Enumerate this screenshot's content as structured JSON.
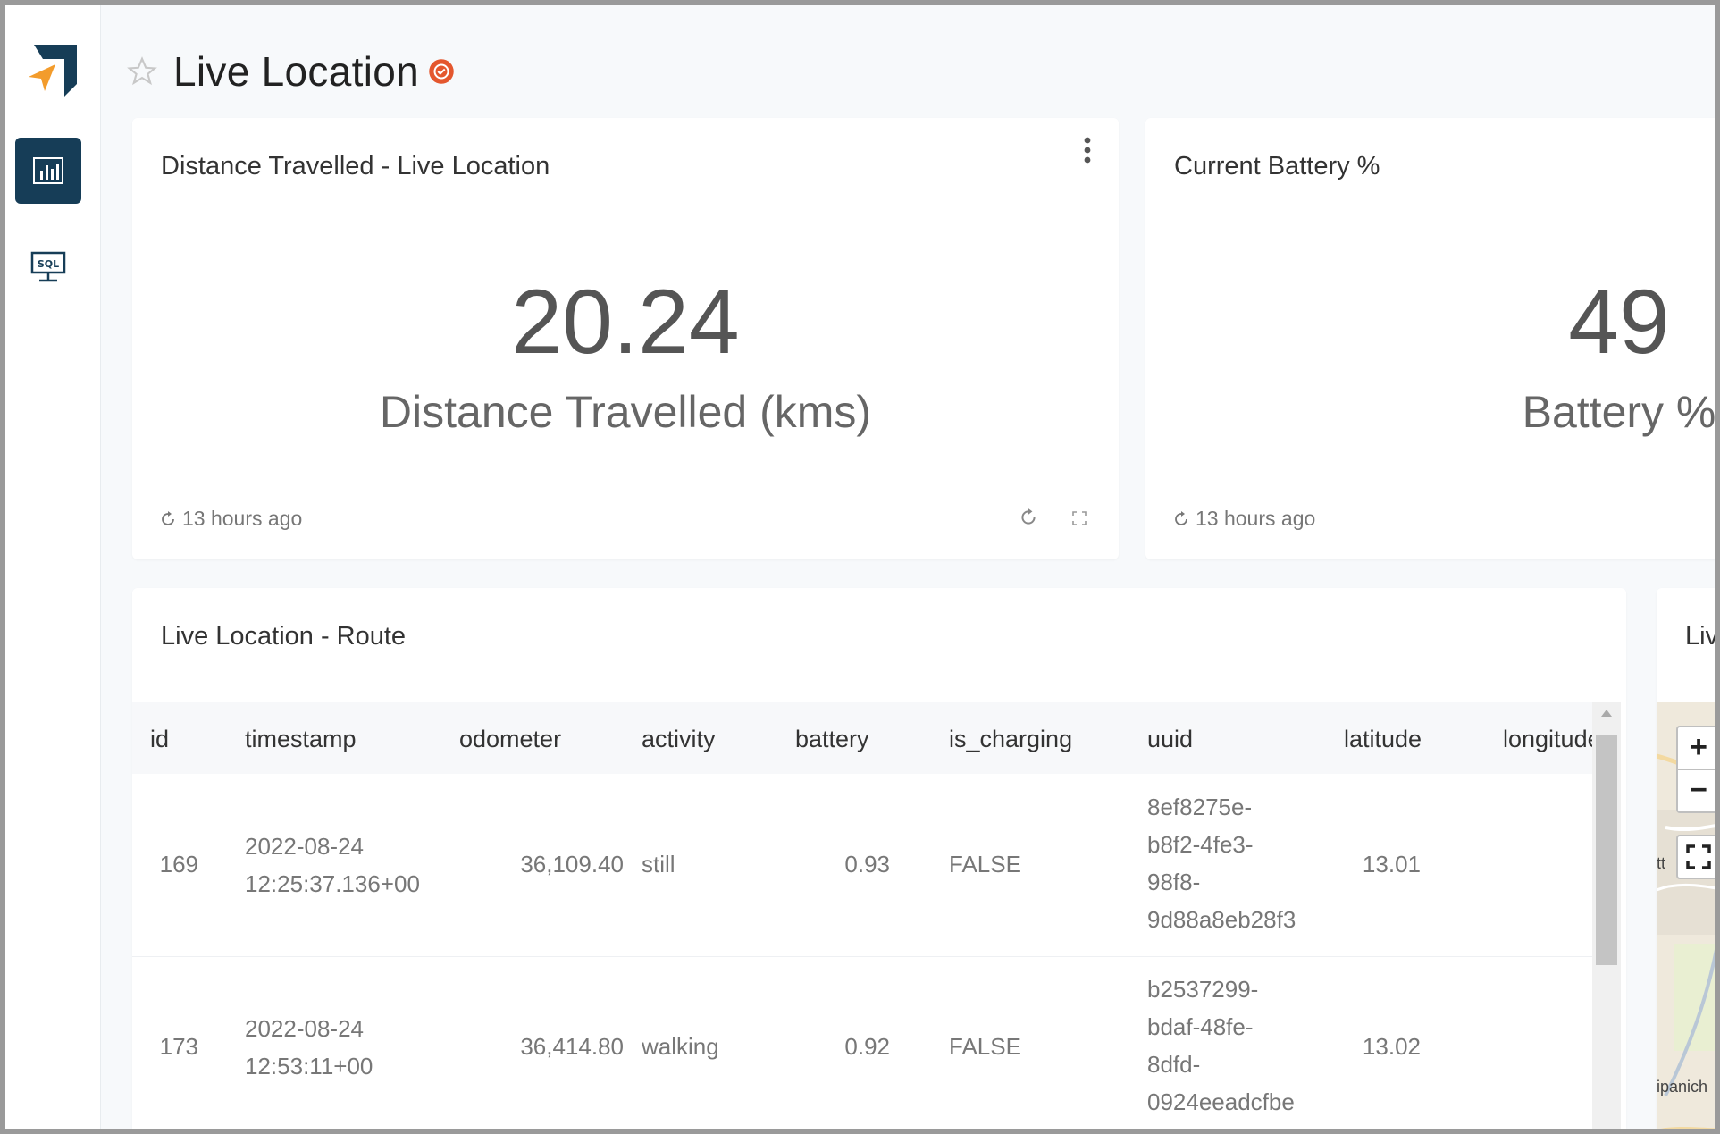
{
  "page": {
    "title": "Live Location"
  },
  "cards": {
    "distance": {
      "title": "Distance Travelled - Live Location",
      "value": "20.24",
      "label": "Distance Travelled (kms)",
      "updated": "13 hours ago"
    },
    "battery": {
      "title": "Current Battery %",
      "value": "49",
      "label": "Battery %",
      "updated": "13 hours ago"
    },
    "route": {
      "title": "Live Location - Route",
      "columns": [
        "id",
        "timestamp",
        "odometer",
        "activity",
        "battery",
        "is_charging",
        "uuid",
        "latitude",
        "longitude"
      ],
      "rows": [
        {
          "id": "169",
          "timestamp_line1": "2022-08-24",
          "timestamp_line2": "12:25:37.136+00",
          "odometer": "36,109.40",
          "activity": "still",
          "battery": "0.93",
          "is_charging": "FALSE",
          "uuid_lines": [
            "8ef8275e-",
            "b8f2-4fe3-",
            "98f8-",
            "9d88a8eb28f3"
          ],
          "latitude": "13.01"
        },
        {
          "id": "173",
          "timestamp_line1": "2022-08-24",
          "timestamp_line2": "12:53:11+00",
          "odometer": "36,414.80",
          "activity": "walking",
          "battery": "0.92",
          "is_charging": "FALSE",
          "uuid_lines": [
            "b2537299-",
            "bdaf-48fe-",
            "8dfd-",
            "0924eeadcfbe"
          ],
          "latitude": "13.02"
        }
      ]
    },
    "map": {
      "title": "Live",
      "zoom_in": "+",
      "zoom_out": "−",
      "place_label": "ipanich",
      "side_label": "tt"
    }
  },
  "icons": {
    "sidebar_dashboard": "bar-chart-icon",
    "sidebar_sql": "sql-monitor-icon",
    "favorite": "star-icon",
    "certified": "certified-badge-icon",
    "refresh": "refresh-icon",
    "menu": "more-vertical-icon",
    "fullscreen": "fullscreen-icon"
  },
  "colors": {
    "sidebar_active": "#163d57",
    "badge": "#e4572e",
    "logo_primary": "#163d57",
    "logo_accent": "#f39c2c"
  }
}
